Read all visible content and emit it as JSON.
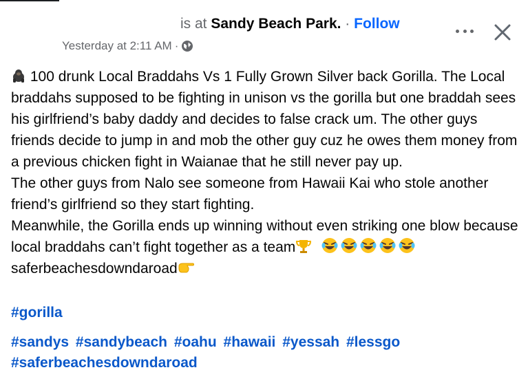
{
  "header": {
    "prefix": "is at",
    "location": "Sandy Beach Park.",
    "separator": "·",
    "follow_label": "Follow",
    "timestamp": "Yesterday at 2:11 AM",
    "timestamp_sep": "·"
  },
  "post": {
    "lines": [
      "100 drunk Local Braddahs Vs 1 Fully Grown Silver back Gorilla. The Local braddahs supposed to be fighting in unison vs the gorilla but one braddah sees his girlfriend’s baby daddy and decides to false crack um. The other guys friends decide to jump in and mob the other guy cuz he owes them money from a previous chicken fight in Waianae that he still never pay up.",
      "The other guys from Nalo see someone from Hawaii Kai who stole another friend’s girlfriend so they start fighting.",
      "Meanwhile, the Gorilla ends up winning without even striking one blow because local braddahs can’t fight together as a team"
    ],
    "signoff": "saferbeachesdowndaroad"
  },
  "hashtags_inline": [
    "#gorilla"
  ],
  "hashtags": [
    "#sandys",
    "#sandybeach",
    "#oahu",
    "#hawaii",
    "#yessah",
    "#lessgo"
  ],
  "hashtags_last": [
    "#saferbeachesdowndaroad"
  ],
  "icons": {
    "globe": "globe-icon",
    "more": "more-options-icon",
    "close": "close-icon",
    "gorilla": "gorilla-emoji",
    "trophy": "trophy-emoji",
    "laugh": "rolling-laughing-emoji",
    "pointing": "pointing-right-emoji"
  },
  "colors": {
    "link": "#0866ff",
    "hashtag": "#0a58ca",
    "muted": "#65676b",
    "text": "#050505"
  }
}
